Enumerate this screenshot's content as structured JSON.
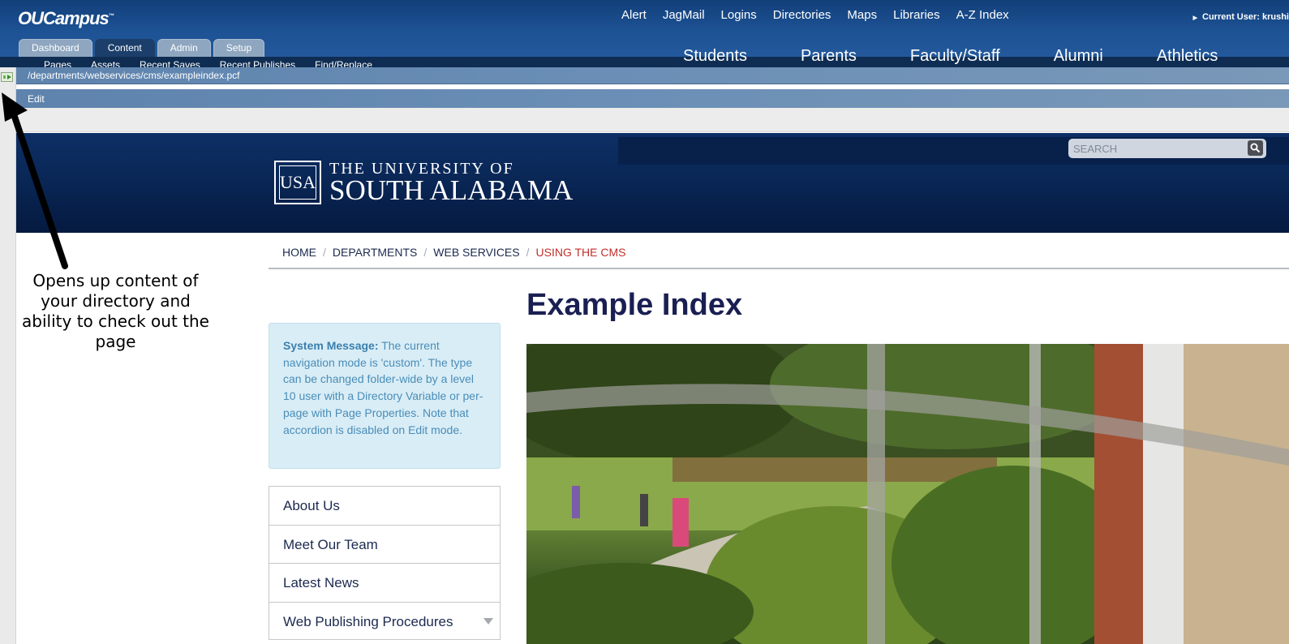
{
  "ou": {
    "logo": "OUCampus",
    "logo_tm": "™",
    "current_user": "Current User: krushi",
    "tabs": [
      "Dashboard",
      "Content",
      "Admin",
      "Setup"
    ],
    "active_tab": "Content",
    "subnav": [
      "Pages",
      "Assets",
      "Recent Saves",
      "Recent Publishes",
      "Find/Replace"
    ],
    "path": "/departments/webservices/cms/exampleindex.pcf",
    "edit_label": "Edit"
  },
  "site": {
    "utility_links": [
      "Alert",
      "JagMail",
      "Logins",
      "Directories",
      "Maps",
      "Libraries",
      "A-Z Index"
    ],
    "search_placeholder": "SEARCH",
    "logo_mark": "USA",
    "logo_line1": "THE UNIVERSITY OF",
    "logo_line2": "SOUTH ALABAMA",
    "main_nav": [
      "Students",
      "Parents",
      "Faculty/Staff",
      "Alumni",
      "Athletics"
    ],
    "breadcrumb": [
      "HOME",
      "DEPARTMENTS",
      "WEB SERVICES",
      "USING THE CMS"
    ],
    "page_title": "Example Index",
    "system_message": {
      "label": "System Message:",
      "text": " The current navigation mode is 'custom'. The type can be changed folder-wide by a level 10 user with a Directory Variable or per-page with Page Properties. Note that accordion is disabled on Edit mode."
    },
    "side_nav": [
      "About Us",
      "Meet Our Team",
      "Latest News",
      "Web Publishing Procedures"
    ]
  },
  "annotation": {
    "text": "Opens up content of your directory and ability to check out the page"
  },
  "colors": {
    "ou_blue": "#1d5294",
    "site_navy": "#0a2858",
    "breadcrumb_current": "#c0302c",
    "title": "#1a1f52",
    "message_bg": "#d9edf6"
  }
}
